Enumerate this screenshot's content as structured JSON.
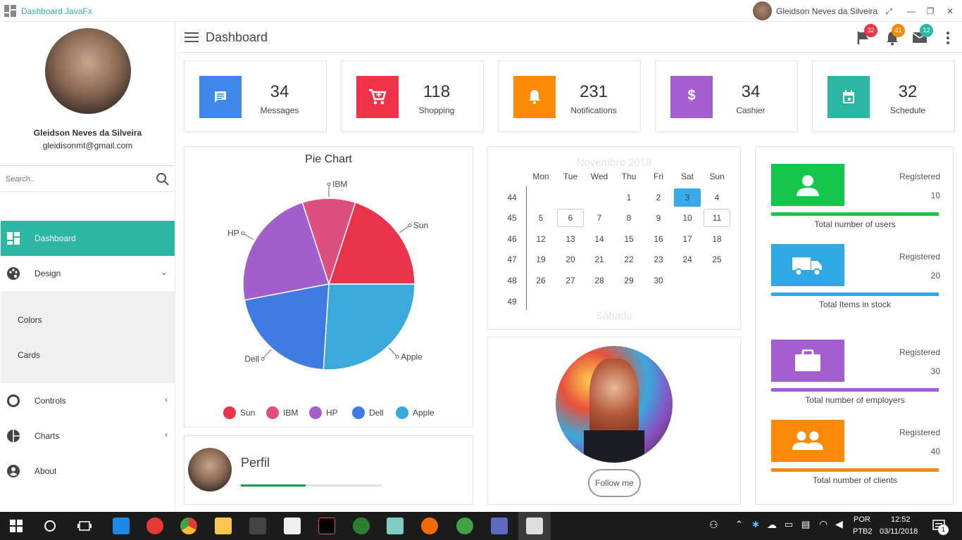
{
  "window": {
    "title": "Dashboard JavaFx",
    "user_name": "Gleidson Neves da Silveira"
  },
  "sidebar": {
    "profile_name": "Gleidson Neves da Silveira",
    "profile_email": "gleidisonmt@gmail.com",
    "search_placeholder": "Search..",
    "items": [
      {
        "label": "Dashboard",
        "icon": "dashboard-icon",
        "active": true
      },
      {
        "label": "Design",
        "icon": "palette-icon"
      },
      {
        "label": "Colors"
      },
      {
        "label": "Cards"
      },
      {
        "label": "Controls",
        "icon": "circle-icon"
      },
      {
        "label": "Charts",
        "icon": "pie-icon"
      },
      {
        "label": "About",
        "icon": "account-icon"
      }
    ]
  },
  "header": {
    "title": "Dashboard",
    "flag_count": "32",
    "bell_count": "41",
    "mail_count": "12"
  },
  "stats": [
    {
      "value": "34",
      "label": "Messages",
      "color": "#3f86ea",
      "icon": "message-icon"
    },
    {
      "value": "118",
      "label": "Shopping",
      "color": "#f03349",
      "icon": "cart-icon"
    },
    {
      "value": "231",
      "label": "Notifications",
      "color": "#fb8a09",
      "icon": "bell-icon"
    },
    {
      "value": "34",
      "label": "Cashier",
      "color": "#a45ecf",
      "icon": "dollar-icon"
    },
    {
      "value": "32",
      "label": "Schedule",
      "color": "#2bb7a3",
      "icon": "calendar-icon"
    }
  ],
  "pie": {
    "title": "Pie Chart"
  },
  "chart_data": {
    "type": "pie",
    "title": "Pie Chart",
    "categories": [
      "Sun",
      "IBM",
      "HP",
      "Dell",
      "Apple"
    ],
    "values": [
      20,
      10,
      23,
      21,
      26
    ],
    "colors": [
      "#e8334a",
      "#dc4f7f",
      "#a15fcb",
      "#3f7be3",
      "#3aa9dc"
    ],
    "legend": "bottom"
  },
  "calendar": {
    "month": "Novembro 2018",
    "footer": "Sábado",
    "days": [
      "Mon",
      "Tue",
      "Wed",
      "Thu",
      "Fri",
      "Sat",
      "Sun"
    ],
    "weeks": [
      "44",
      "45",
      "46",
      "47",
      "48",
      "49"
    ],
    "rows": [
      [
        "",
        "",
        "",
        "1",
        "2",
        "3",
        "4"
      ],
      [
        "5",
        "6",
        "7",
        "8",
        "9",
        "10",
        "11"
      ],
      [
        "12",
        "13",
        "14",
        "15",
        "16",
        "17",
        "18"
      ],
      [
        "19",
        "20",
        "21",
        "22",
        "23",
        "24",
        "25"
      ],
      [
        "26",
        "27",
        "28",
        "29",
        "30",
        "",
        ""
      ],
      [
        "",
        "",
        "",
        "",
        "",
        "",
        ""
      ]
    ],
    "selected": "3"
  },
  "perfil": {
    "label": "Perfil",
    "progress": 0.46
  },
  "follow": {
    "label": "Follow me"
  },
  "registered": [
    {
      "label": "Registered",
      "value": "10",
      "title": "Total number of users",
      "color": "#14c64a",
      "icon": "user-icon"
    },
    {
      "label": "Registered",
      "value": "20",
      "title": "Total Items in stock",
      "color": "#2fa9e3",
      "icon": "truck-icon"
    },
    {
      "label": "Registered",
      "value": "30",
      "title": "Total number of employers",
      "color": "#a45ecf",
      "icon": "briefcase-icon"
    },
    {
      "label": "Registered",
      "value": "40",
      "title": "Total number of clients",
      "color": "#fb8a09",
      "icon": "people-icon"
    }
  ],
  "taskbar": {
    "lang1": "POR",
    "lang2": "PTB2",
    "time": "12:52",
    "date": "03/11/2018",
    "notifications": "1"
  }
}
